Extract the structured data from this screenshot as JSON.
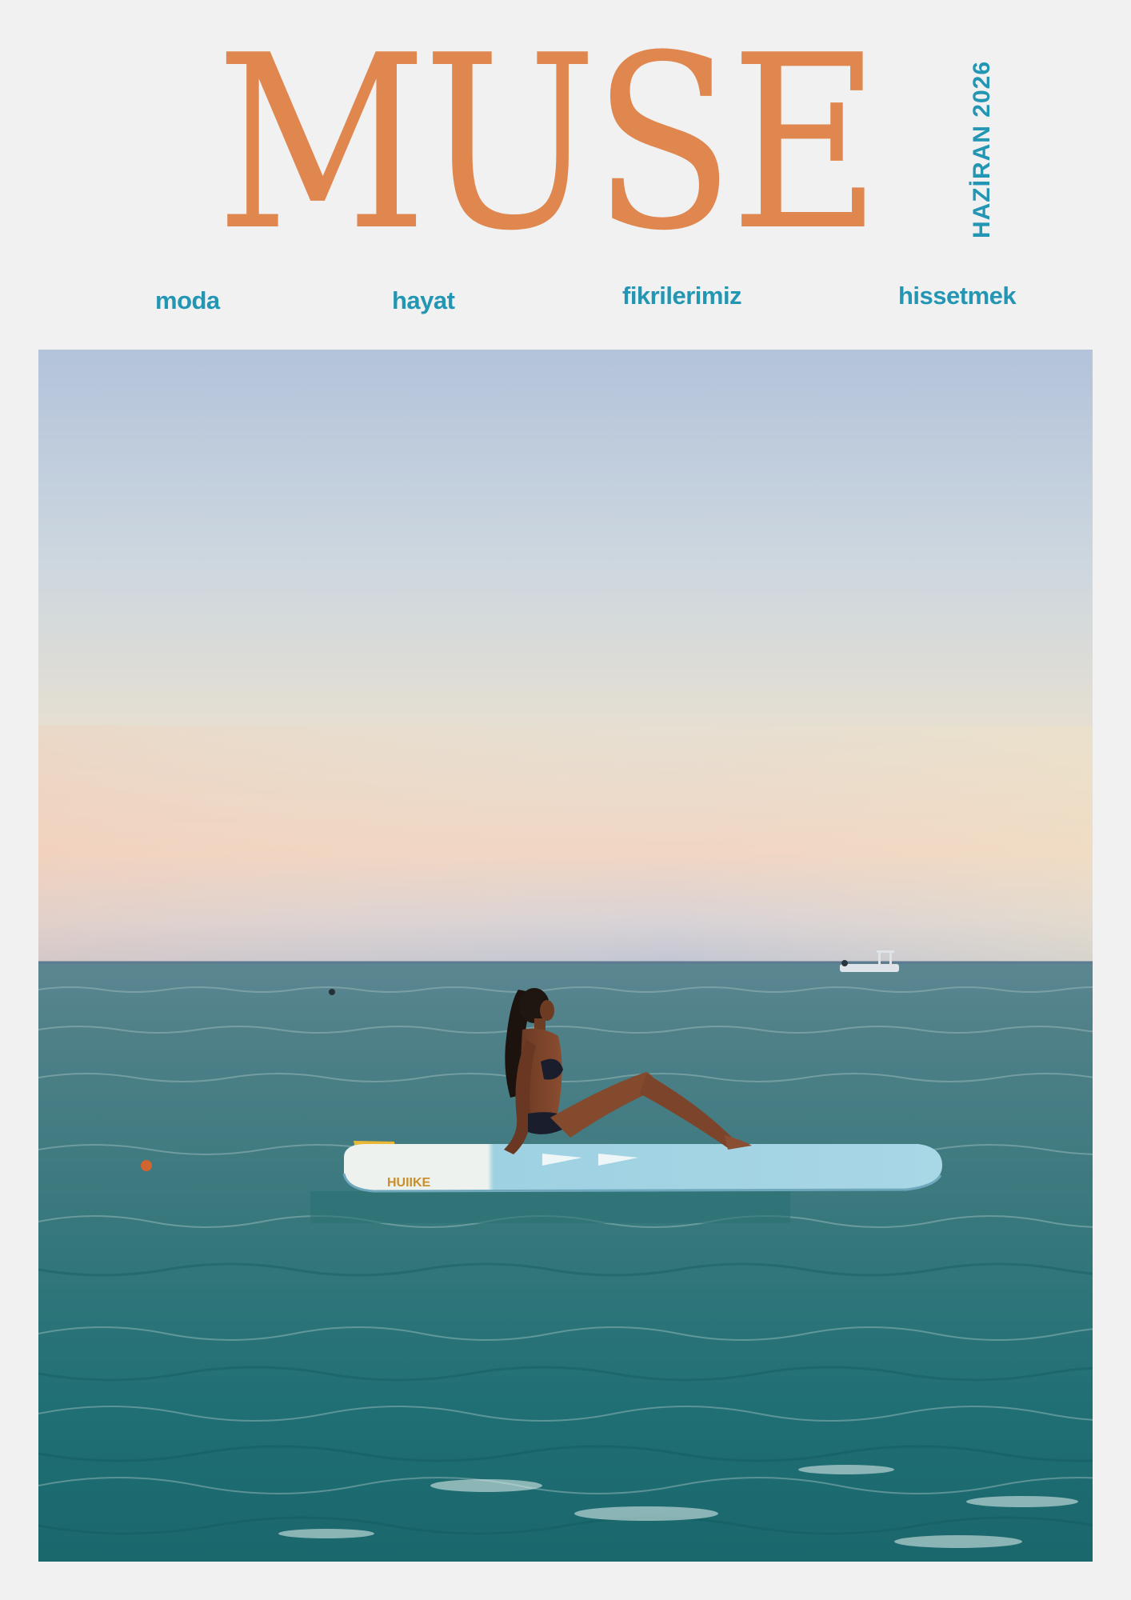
{
  "magazine": {
    "title": "MUSE",
    "issue_date": "HAZİRAN 2026"
  },
  "nav": {
    "items": [
      {
        "label": "moda"
      },
      {
        "label": "hayat"
      },
      {
        "label": "fikrilerimiz"
      },
      {
        "label": "hissetmek"
      }
    ]
  },
  "cover_photo": {
    "board_brand": "HUIIKE"
  },
  "colors": {
    "background": "#f1f1f1",
    "masthead": "#e0874f",
    "accent": "#2296b3",
    "sea": "#2e7b80",
    "sky_top": "#b2c3d9",
    "sky_bottom": "#f1d7c3"
  }
}
